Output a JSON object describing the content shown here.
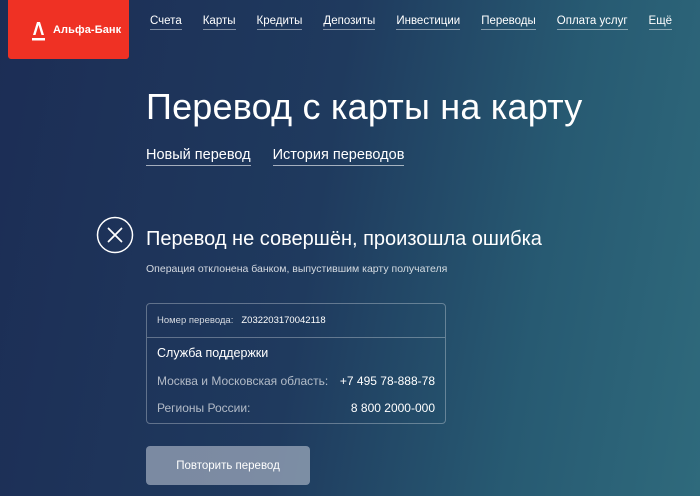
{
  "header": {
    "brand": "Альфа-Банк",
    "brand_color": "#ef3124",
    "nav": [
      "Счета",
      "Карты",
      "Кредиты",
      "Депозиты",
      "Инвестиции",
      "Переводы",
      "Оплата услуг",
      "Ещё"
    ]
  },
  "page": {
    "title": "Перевод с карты на карту",
    "tabs": [
      "Новый перевод",
      "История переводов"
    ]
  },
  "status": {
    "icon": "close-circle-icon",
    "title": "Перевод не совершён, произошла ошибка",
    "description": "Операция отклонена банком, выпустившим карту получателя"
  },
  "card": {
    "transfer_label": "Номер перевода:",
    "transfer_number": "Z032203170042118",
    "support_title": "Служба поддержки",
    "rows": [
      {
        "label": "Москва и Московская область:",
        "value": "+7 495 78-888-78"
      },
      {
        "label": "Регионы России:",
        "value": "8 800 2000-000"
      }
    ]
  },
  "actions": {
    "retry_label": "Повторить перевод"
  }
}
